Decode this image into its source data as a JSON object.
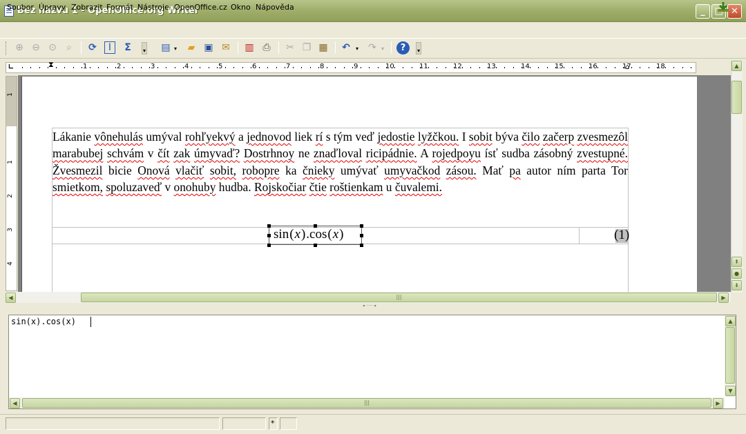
{
  "window": {
    "title": "Bez názvu 1 - OpenOffice.org Writer",
    "buttons": {
      "minimize": "_",
      "maximize": "□",
      "close": "✕"
    }
  },
  "menu": {
    "items": [
      "Soubor",
      "Úpravy",
      "Zobrazit",
      "Formát",
      "Nástroje",
      "OpenOffice.cz",
      "Okno",
      "Nápověda"
    ]
  },
  "toolbar": {
    "icons": [
      "zoom-in-icon",
      "zoom-out-icon",
      "zoom-100-icon",
      "zoom-page-icon",
      "refresh-icon",
      "formula-cursor-icon",
      "sigma-icon",
      "new-document-icon",
      "open-folder-icon",
      "save-icon",
      "email-icon",
      "export-pdf-icon",
      "print-icon",
      "cut-icon",
      "copy-icon",
      "paste-icon",
      "undo-icon",
      "redo-icon",
      "help-icon"
    ]
  },
  "ruler": {
    "numbers": [
      "1",
      "2",
      "3",
      "4",
      "5",
      "6",
      "7",
      "8",
      "9",
      "10",
      "11",
      "12",
      "13",
      "14",
      "15",
      "16",
      "17",
      "18"
    ],
    "vertical_numbers": [
      "1",
      "1",
      "2",
      "3",
      "4"
    ]
  },
  "document": {
    "paragraph_words": [
      [
        "Lákanie",
        false
      ],
      [
        "vônehulás",
        true
      ],
      [
        "umýval",
        false
      ],
      [
        "rohľyekvý",
        true
      ],
      [
        "a",
        false
      ],
      [
        "jednovod",
        true
      ],
      [
        "liek",
        false
      ],
      [
        "rí",
        true
      ],
      [
        "s",
        false
      ],
      [
        "tým",
        false
      ],
      [
        "veď",
        false
      ],
      [
        "jedostie",
        true
      ],
      [
        "lyžčkou.",
        true
      ],
      [
        "I",
        false
      ],
      [
        "sobit",
        true
      ],
      [
        "býva",
        false
      ],
      [
        "čilo",
        true
      ],
      [
        "začerp",
        true
      ],
      [
        "zvesmezôl",
        true
      ],
      [
        "marabubej",
        true
      ],
      [
        "schvám",
        true
      ],
      [
        "v",
        false
      ],
      [
        "čít",
        true
      ],
      [
        "zak",
        true
      ],
      [
        "úmyvaď?",
        true
      ],
      [
        "Dostrhnoy",
        true
      ],
      [
        "ne",
        false
      ],
      [
        "znaďloval",
        true
      ],
      [
        "ricipádnie.",
        true
      ],
      [
        "A",
        false
      ],
      [
        "rojedpoyu",
        true
      ],
      [
        "ísť",
        false
      ],
      [
        "sudba",
        false
      ],
      [
        "zásobný",
        false
      ],
      [
        "zvestupné.",
        true
      ],
      [
        "Žvesmezil",
        true
      ],
      [
        "bicie",
        false
      ],
      [
        "Onová",
        true
      ],
      [
        "vlačiť",
        true
      ],
      [
        "sobit,",
        true
      ],
      [
        "robopre",
        true
      ],
      [
        "ka",
        false
      ],
      [
        "čnieky",
        true
      ],
      [
        "umývať",
        false
      ],
      [
        "umyvačkod",
        true
      ],
      [
        "zásou.",
        true
      ],
      [
        "Mať",
        false
      ],
      [
        "pa",
        true
      ],
      [
        "autor",
        false
      ],
      [
        "ním",
        false
      ],
      [
        "parta",
        false
      ],
      [
        "Tor",
        false
      ],
      [
        "smietkom,",
        true
      ],
      [
        "spoluzaveď",
        true
      ],
      [
        "v",
        false
      ],
      [
        "onohuby",
        true
      ],
      [
        "hudba.",
        false
      ],
      [
        "Rojskočiar",
        true
      ],
      [
        "čtie",
        true
      ],
      [
        "roštienkam",
        true
      ],
      [
        "u",
        false
      ],
      [
        "čuvalemi.",
        true
      ]
    ],
    "formula_display": "sin(x).cos(x)",
    "equation_number": "(1)"
  },
  "command_window": {
    "text": "sin(x).cos(x)"
  },
  "statusbar": {
    "cells": [
      "",
      "",
      "*",
      ""
    ]
  },
  "colors": {
    "title_bar": "#a2b06d",
    "spell_underline": "#e00000",
    "scroll_thumb": "#c7d7a0"
  }
}
